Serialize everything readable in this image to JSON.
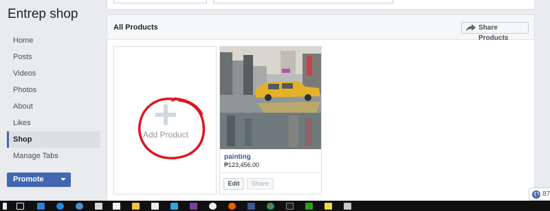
{
  "sidebar": {
    "page_name": "Entrep shop",
    "items": [
      {
        "label": "Home"
      },
      {
        "label": "Posts"
      },
      {
        "label": "Videos"
      },
      {
        "label": "Photos"
      },
      {
        "label": "About"
      },
      {
        "label": "Likes"
      },
      {
        "label": "Shop",
        "active": true
      },
      {
        "label": "Manage Tabs"
      }
    ],
    "promote_label": "Promote"
  },
  "panel": {
    "title": "All Products",
    "share_label": "Share Products",
    "add_product_label": "Add Product",
    "products": [
      {
        "name": "painting",
        "price": "₱123,456.00",
        "edit_label": "Edit",
        "share_label": "Share"
      }
    ]
  },
  "chat_widget": {
    "count": "87",
    "icon": "globe-icon"
  },
  "colors": {
    "accent": "#4267b2",
    "link": "#365899",
    "background": "#e9ebee",
    "annotation": "#e0141e"
  }
}
